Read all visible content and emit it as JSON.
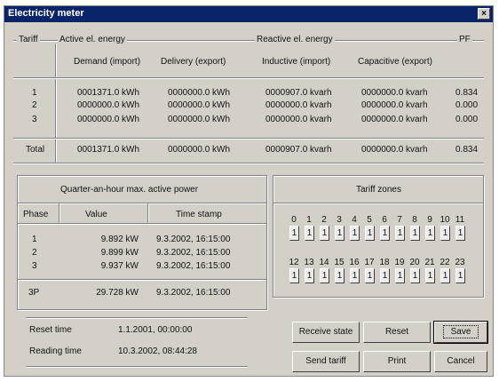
{
  "window": {
    "title": "Electricity meter",
    "close": "×"
  },
  "energy": {
    "tariff_label": "Tariff",
    "active_label": "Active el. energy",
    "reactive_label": "Reactive el. energy",
    "pf_label": "PF",
    "col_demand": "Demand (import)",
    "col_delivery": "Delivery (export)",
    "col_inductive": "Inductive (import)",
    "col_capacitive": "Capacitive (export)",
    "rows": [
      {
        "tariff": "1",
        "demand": "0001371.0 kWh",
        "delivery": "0000000.0 kWh",
        "inductive": "0000907.0 kvarh",
        "capacitive": "0000000.0 kvarh",
        "pf": "0.834"
      },
      {
        "tariff": "2",
        "demand": "0000000.0 kWh",
        "delivery": "0000000.0 kWh",
        "inductive": "0000000.0 kvarh",
        "capacitive": "0000000.0 kvarh",
        "pf": "0.000"
      },
      {
        "tariff": "3",
        "demand": "0000000.0 kWh",
        "delivery": "0000000.0 kWh",
        "inductive": "0000000.0 kvarh",
        "capacitive": "0000000.0 kvarh",
        "pf": "0.000"
      }
    ],
    "total": {
      "tariff": "Total",
      "demand": "0001371.0 kWh",
      "delivery": "0000000.0 kWh",
      "inductive": "0000907.0 kvarh",
      "capacitive": "0000000.0 kvarh",
      "pf": "0.834"
    }
  },
  "power": {
    "title": "Quarter-an-hour max. active power",
    "col_phase": "Phase",
    "col_value": "Value",
    "col_time": "Time stamp",
    "rows": [
      {
        "phase": "1",
        "value": "9.892 kW",
        "time": "9.3.2002,  16:15:00"
      },
      {
        "phase": "2",
        "value": "9.899 kW",
        "time": "9.3.2002,  16:15:00"
      },
      {
        "phase": "3",
        "value": "9.937 kW",
        "time": "9.3.2002,  16:15:00"
      }
    ],
    "total": {
      "phase": "3P",
      "value": "29.728 kW",
      "time": "9.3.2002,  16:15:00"
    }
  },
  "tariff_zones": {
    "title": "Tariff zones",
    "hours": [
      "0",
      "1",
      "2",
      "3",
      "4",
      "5",
      "6",
      "7",
      "8",
      "9",
      "10",
      "11",
      "12",
      "13",
      "14",
      "15",
      "16",
      "17",
      "18",
      "19",
      "20",
      "21",
      "22",
      "23"
    ],
    "values": [
      "1",
      "1",
      "1",
      "1",
      "1",
      "1",
      "1",
      "1",
      "1",
      "1",
      "1",
      "1",
      "1",
      "1",
      "1",
      "1",
      "1",
      "1",
      "1",
      "1",
      "1",
      "1",
      "1",
      "1"
    ]
  },
  "times": {
    "reset_label": "Reset time",
    "reset_value": "1.1.2001,  00:00:00",
    "reading_label": "Reading time",
    "reading_value": "10.3.2002,  08:44:28"
  },
  "buttons": {
    "receive": "Receive state",
    "reset": "Reset",
    "save": "Save",
    "send": "Send tariff",
    "print": "Print",
    "cancel": "Cancel"
  }
}
